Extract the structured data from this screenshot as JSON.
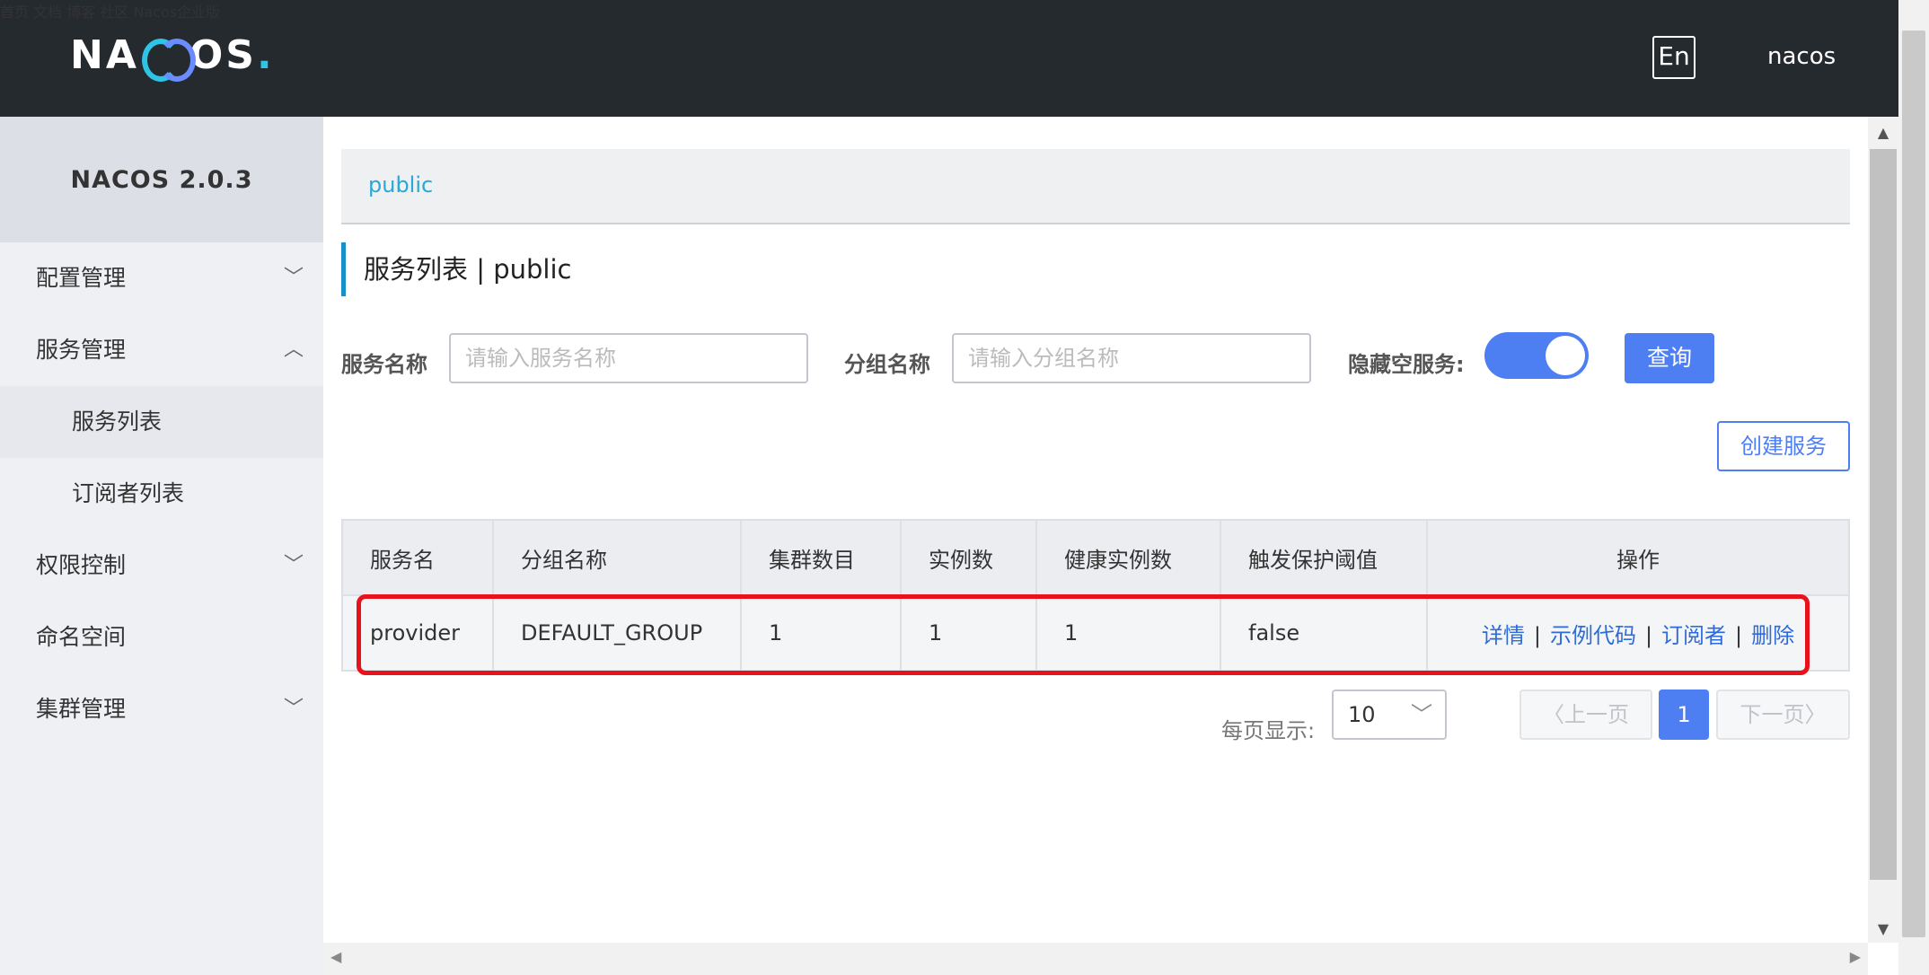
{
  "header": {
    "logo_text": "NACOS.",
    "nav": [
      "首页",
      "文档",
      "博客",
      "社区",
      "Nacos企业版"
    ],
    "lang_button": "En",
    "user": "nacos"
  },
  "sidebar": {
    "title": "NACOS 2.0.3",
    "items": [
      {
        "label": "配置管理",
        "chevron": "chevron-down-icon"
      },
      {
        "label": "服务管理",
        "chevron": "chevron-up-icon"
      },
      {
        "label": "服务列表"
      },
      {
        "label": "订阅者列表"
      },
      {
        "label": "权限控制",
        "chevron": "chevron-down-icon"
      },
      {
        "label": "命名空间"
      },
      {
        "label": "集群管理",
        "chevron": "chevron-down-icon"
      }
    ]
  },
  "namespace": "public",
  "page_title": "服务列表  |  public",
  "filters": {
    "service_name_label": "服务名称",
    "service_name_placeholder": "请输入服务名称",
    "group_name_label": "分组名称",
    "group_name_placeholder": "请输入分组名称",
    "hide_empty_label": "隐藏空服务:",
    "hide_empty_on": true,
    "query_button": "查询"
  },
  "create_button": "创建服务",
  "table": {
    "headers": [
      "服务名",
      "分组名称",
      "集群数目",
      "实例数",
      "健康实例数",
      "触发保护阈值",
      "操作"
    ],
    "rows": [
      {
        "service": "provider",
        "group": "DEFAULT_GROUP",
        "clusters": "1",
        "instances": "1",
        "healthy": "1",
        "protect": "false",
        "ops": [
          "详情",
          "示例代码",
          "订阅者",
          "删除"
        ]
      }
    ]
  },
  "pagination": {
    "per_page_label": "每页显示:",
    "per_page_value": "10",
    "prev": "上一页",
    "current": "1",
    "next": "下一页"
  },
  "colors": {
    "header_bg": "#252a2f",
    "primary": "#4d7ef2",
    "link": "#2f6bd8",
    "highlight_border": "#e8121d"
  }
}
